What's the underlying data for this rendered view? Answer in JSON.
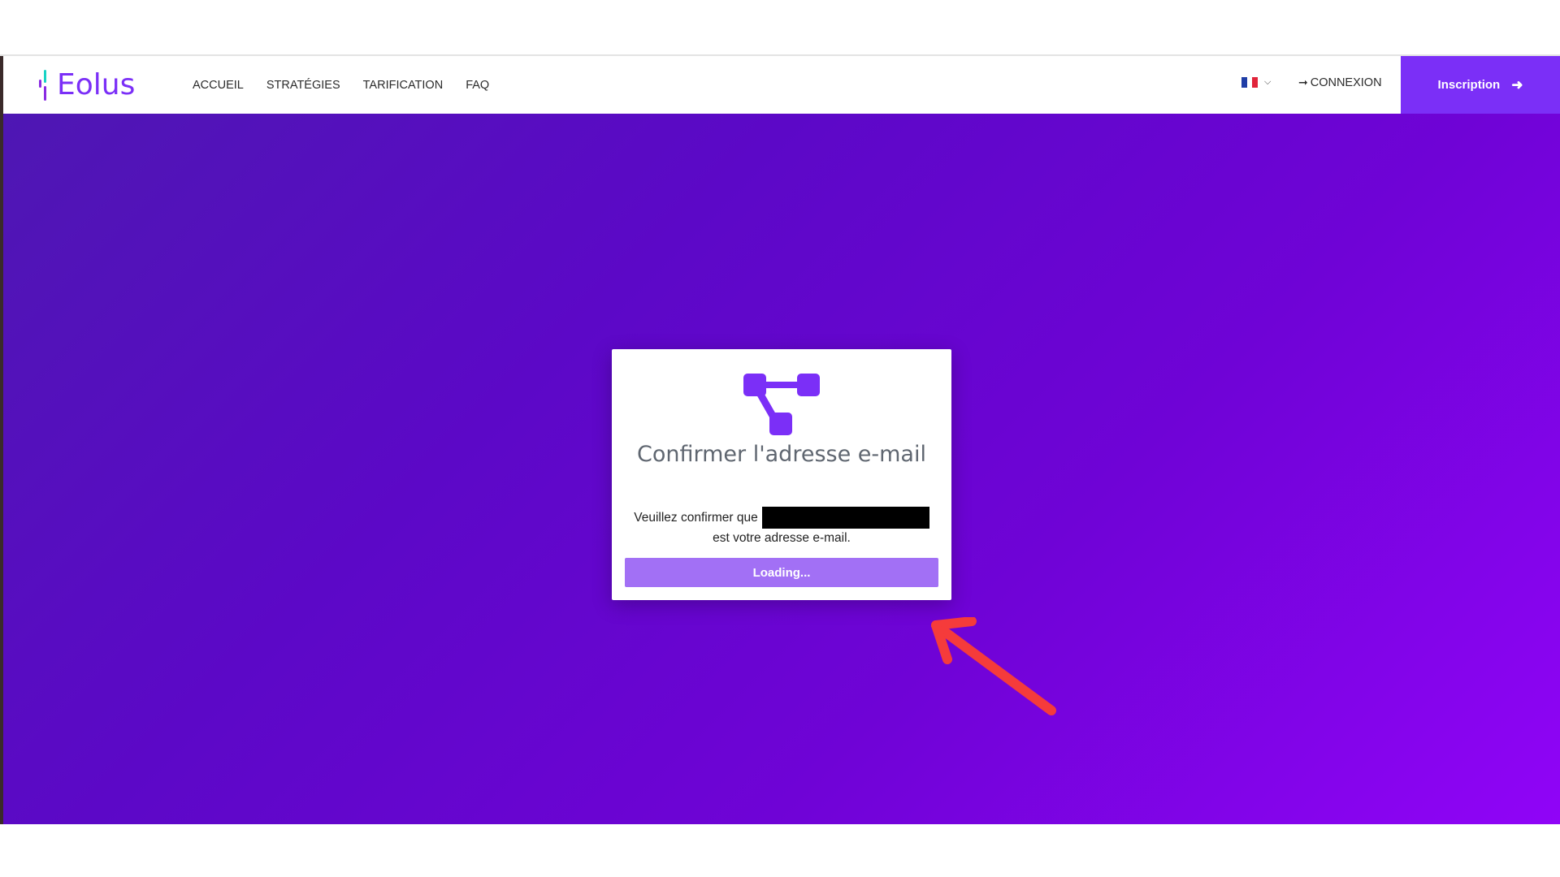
{
  "brand": {
    "name": "Eolus",
    "primary_color": "#7b2ff7",
    "accent_color": "#19d3c5"
  },
  "nav": {
    "items": [
      {
        "label": "ACCUEIL"
      },
      {
        "label": "STRATÉGIES"
      },
      {
        "label": "TARIFICATION"
      },
      {
        "label": "FAQ"
      }
    ],
    "language": {
      "selected": "fr",
      "icon": "france-flag-icon"
    },
    "login_label": "CONNEXION",
    "signup_label": "Inscription"
  },
  "confirm_card": {
    "title": "Confirmer l'adresse e-mail",
    "text_before": "Veuillez confirmer que",
    "text_after": "est votre adresse e-mail.",
    "email_redacted": true,
    "button_label": "Loading..."
  },
  "colors": {
    "hero_gradient_start": "#4e17b3",
    "hero_gradient_end": "#9004f7",
    "button_loading": "#a270f5",
    "annotation_arrow": "#f53b3b"
  }
}
